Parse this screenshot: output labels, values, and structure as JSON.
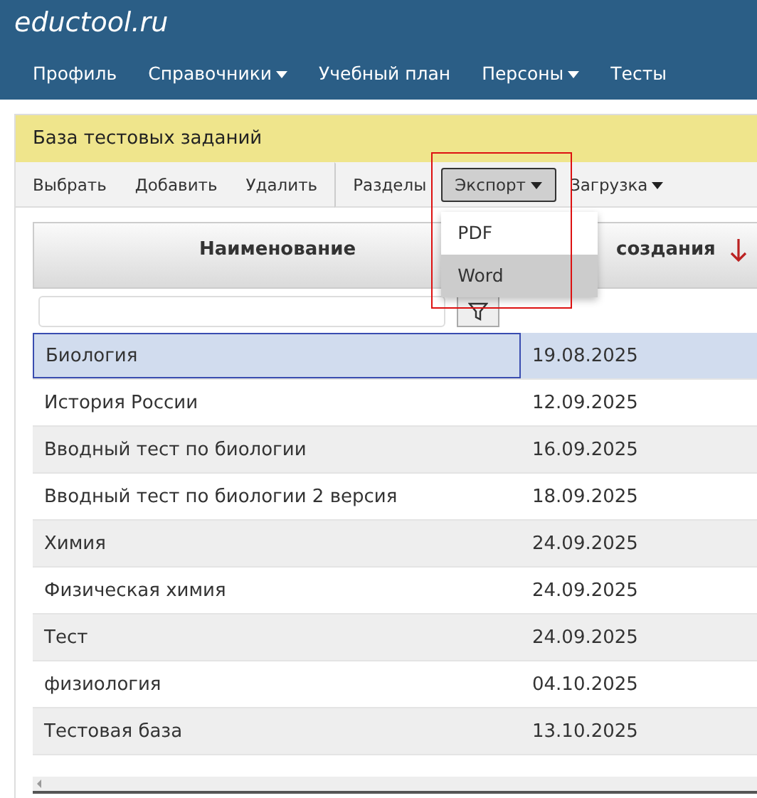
{
  "logo": "eductool.ru",
  "nav": [
    {
      "label": "Профиль",
      "dropdown": false
    },
    {
      "label": "Справочники",
      "dropdown": true
    },
    {
      "label": "Учебный план",
      "dropdown": false
    },
    {
      "label": "Персоны",
      "dropdown": true
    },
    {
      "label": "Тесты",
      "dropdown": false
    }
  ],
  "panel_title": "База тестовых заданий",
  "toolbar": [
    {
      "label": "Выбрать",
      "dropdown": false,
      "selected": false,
      "separator_before": false
    },
    {
      "label": "Добавить",
      "dropdown": false,
      "selected": false,
      "separator_before": false
    },
    {
      "label": "Удалить",
      "dropdown": false,
      "selected": false,
      "separator_before": false
    },
    {
      "label": "Разделы",
      "dropdown": false,
      "selected": false,
      "separator_before": true
    },
    {
      "label": "Экспорт",
      "dropdown": true,
      "selected": true,
      "separator_before": false
    },
    {
      "label": "Загрузка",
      "dropdown": true,
      "selected": false,
      "separator_before": false
    }
  ],
  "export_menu": [
    {
      "label": "PDF",
      "selected": false
    },
    {
      "label": "Word",
      "selected": true
    }
  ],
  "table": {
    "columns": [
      {
        "label": "Наименование",
        "sorted_desc": false
      },
      {
        "label": "создания",
        "sorted_desc": true
      }
    ],
    "rows": [
      {
        "name": "Биология",
        "date": "19.08.2025",
        "selected": true
      },
      {
        "name": "История России",
        "date": "12.09.2025",
        "selected": false
      },
      {
        "name": "Вводный тест по биологии",
        "date": "16.09.2025",
        "selected": false
      },
      {
        "name": "Вводный тест по биологии 2 версия",
        "date": "18.09.2025",
        "selected": false
      },
      {
        "name": "Химия",
        "date": "24.09.2025",
        "selected": false
      },
      {
        "name": "Физическая химия",
        "date": "24.09.2025",
        "selected": false
      },
      {
        "name": "Тест",
        "date": "24.09.2025",
        "selected": false
      },
      {
        "name": "физиология",
        "date": "04.10.2025",
        "selected": false
      },
      {
        "name": "Тестовая база",
        "date": "13.10.2025",
        "selected": false
      }
    ]
  }
}
